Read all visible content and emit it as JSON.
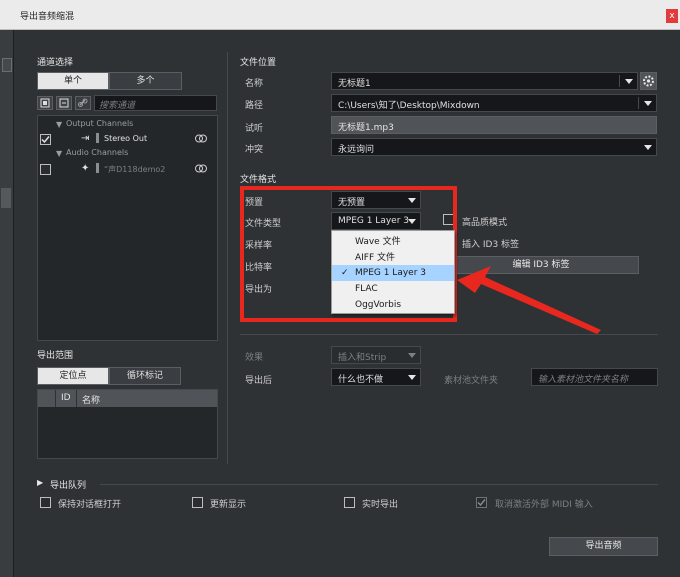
{
  "window": {
    "title": "导出音频缩混",
    "close": "x"
  },
  "channels": {
    "title": "通道选择",
    "seg_single": "单个",
    "seg_multi": "多个",
    "search_placeholder": "搜索通道",
    "tree": {
      "group1": "Output Channels",
      "item1": "Stereo Out",
      "item1_checked": true,
      "group2": "Audio Channels",
      "item2": "“声D118demo2",
      "item2_checked": false
    }
  },
  "range": {
    "title": "导出范围",
    "seg_locators": "定位点",
    "seg_cycle": "循环标记",
    "col_id": "ID",
    "col_name": "名称"
  },
  "file_location": {
    "title": "文件位置",
    "name_label": "名称",
    "name_value": "无标题1",
    "path_label": "路径",
    "path_value": "C:\\Users\\知了\\Desktop\\Mixdown",
    "preview_label": "试听",
    "preview_value": "无标题1.mp3",
    "conflict_label": "冲突",
    "conflict_value": "永远询问"
  },
  "file_format": {
    "title": "文件格式",
    "preset_label": "预置",
    "preset_value": "无预置",
    "filetype_label": "文件类型",
    "filetype_value": "MPEG 1 Layer 3",
    "samplerate_label": "采样率",
    "bitrate_label": "比特率",
    "exportas_label": "导出为",
    "hq_label": "高品质模式",
    "id3_label": "插入 ID3 标签",
    "id3_edit": "编辑 ID3 标签",
    "dropdown_options": [
      "Wave 文件",
      "AIFF 文件",
      "MPEG 1 Layer 3",
      "FLAC",
      "OggVorbis"
    ],
    "dropdown_selected": "MPEG 1 Layer 3",
    "checkmark": "✓"
  },
  "post": {
    "effect_label": "效果",
    "effect_value": "插入和Strip",
    "after_label": "导出后",
    "after_value": "什么也不做",
    "pool_label": "素材池文件夹",
    "pool_placeholder": "输入素材池文件夹名称"
  },
  "queue": {
    "title": "导出队列",
    "keep_open": "保持对话框打开",
    "update_display": "更新显示",
    "realtime": "实时导出",
    "deactivate_midi": "取消激活外部 MIDI 输入",
    "export_button": "导出音频"
  },
  "colors": {
    "highlight": "#e8281e",
    "selection": "#a6d3ff"
  }
}
